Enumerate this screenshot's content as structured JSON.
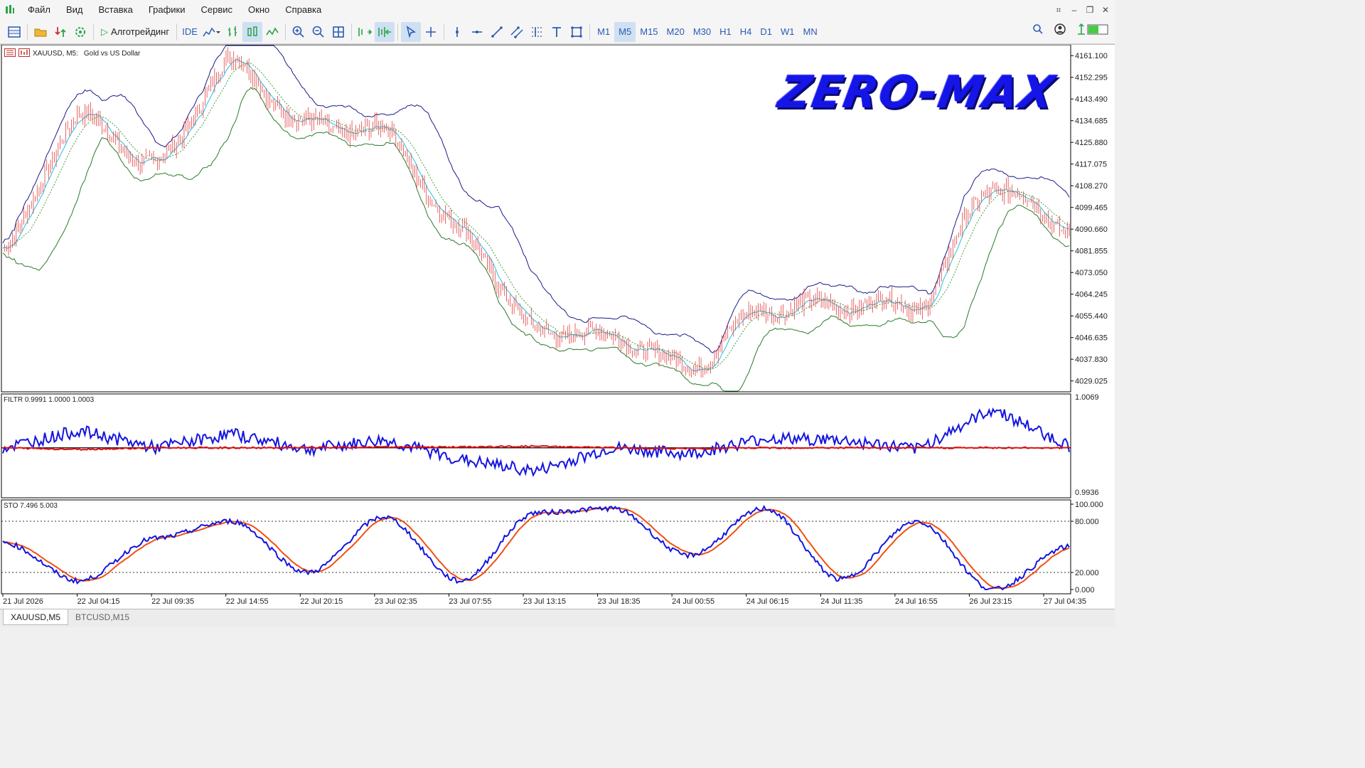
{
  "menu": {
    "items": [
      "Файл",
      "Вид",
      "Вставка",
      "Графики",
      "Сервис",
      "Окно",
      "Справка"
    ]
  },
  "toolbar": {
    "algo_label": "Алготрейдинг",
    "ide_label": "IDE",
    "timeframes": [
      "M1",
      "M5",
      "M15",
      "M20",
      "M30",
      "H1",
      "H4",
      "D1",
      "W1",
      "MN"
    ],
    "active_timeframe": "M5"
  },
  "chart": {
    "symbol_label": "XAUUSD, M5:",
    "symbol_desc": "Gold vs US Dollar",
    "watermark": "ZERO-MAX",
    "price_ticks": [
      "4161.100",
      "4152.295",
      "4143.490",
      "4134.685",
      "4125.880",
      "4117.075",
      "4108.270",
      "4099.465",
      "4090.660",
      "4081.855",
      "4073.050",
      "4064.245",
      "4055.440",
      "4046.635",
      "4037.830",
      "4029.025"
    ],
    "filtr_label": "FILTR 0.9991 1.0000 1.0003",
    "filtr_ticks": [
      "1.0069",
      "0.9936"
    ],
    "sto_label": "STO 7.496 5.003",
    "sto_ticks": [
      "100.000",
      "80.000",
      "20.000",
      "0.000"
    ],
    "time_ticks": [
      "21 Jul 2026",
      "22 Jul 04:15",
      "22 Jul 09:35",
      "22 Jul 14:55",
      "22 Jul 20:15",
      "23 Jul 02:35",
      "23 Jul 07:55",
      "23 Jul 13:15",
      "23 Jul 18:35",
      "24 Jul 00:55",
      "24 Jul 06:15",
      "24 Jul 11:35",
      "24 Jul 16:55",
      "26 Jul 23:15",
      "27 Jul 04:35"
    ],
    "colors": {
      "candles": "#e04040",
      "upper_band": "#1a1a8a",
      "lower_band": "#2a7a2a",
      "ma_fast": "#20c0e0",
      "ma_slow": "#3aa03a",
      "filtr_main": "#1515e0",
      "filtr_signal": "#e01010",
      "sto_main": "#1515e0",
      "sto_signal": "#f05010"
    }
  },
  "chart_data": [
    {
      "type": "line",
      "title": "XAUUSD, M5: Gold vs US Dollar",
      "xlabel": "",
      "ylabel": "",
      "ylim": [
        4024.6,
        4165.5
      ],
      "x": [
        "21 Jul 2026",
        "22 Jul 04:15",
        "22 Jul 09:35",
        "22 Jul 14:55",
        "22 Jul 20:15",
        "23 Jul 02:35",
        "23 Jul 07:55",
        "23 Jul 13:15",
        "23 Jul 18:35",
        "24 Jul 00:55",
        "24 Jul 06:15",
        "24 Jul 11:35",
        "24 Jul 16:55",
        "26 Jul 23:15",
        "27 Jul 04:35"
      ],
      "series": [
        {
          "values": [
            4083,
            4136,
            4117,
            4158,
            4133,
            4130,
            4090,
            4050,
            4047,
            4035,
            4058,
            4060,
            4060,
            4108,
            4092
          ]
        }
      ],
      "grid": false
    },
    {
      "type": "line",
      "title": "FILTR 0.9991 1.0000 1.0003",
      "ylim": [
        0.9936,
        1.0069
      ],
      "series": [
        {
          "values": [
            1.0,
            1.0022,
            1.0,
            1.0018,
            0.9998,
            1.001,
            0.9985,
            0.997,
            1.0,
            0.9992,
            1.0012,
            1.001,
            0.9998,
            1.005,
            1.0002
          ]
        },
        {
          "values": [
            1.0,
            0.9998,
            1.0,
            1.0,
            1.0,
            1.0001,
            1.0001,
            1.0002,
            1.0,
            0.9999,
            1.0,
            1.0,
            1.0,
            1.0,
            1.0
          ]
        }
      ]
    },
    {
      "type": "line",
      "title": "STO 7.496 5.003",
      "ylim": [
        0,
        100
      ],
      "series": [
        {
          "values": [
            55,
            10,
            60,
            80,
            20,
            85,
            10,
            90,
            95,
            40,
            95,
            12,
            80,
            0,
            50
          ]
        },
        {
          "values": [
            50,
            12,
            55,
            75,
            25,
            80,
            15,
            85,
            92,
            45,
            92,
            15,
            78,
            5,
            30
          ]
        }
      ]
    }
  ],
  "tabs": [
    "XAUUSD,M5",
    "BTCUSD,M15"
  ]
}
